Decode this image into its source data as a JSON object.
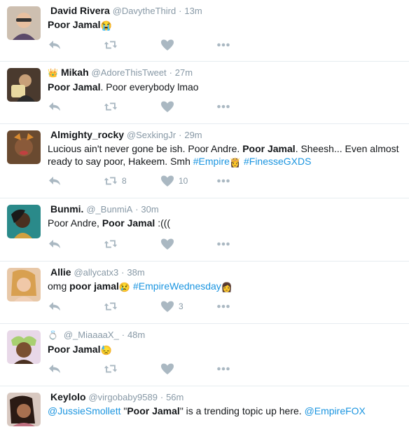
{
  "tweets": [
    {
      "name": "David Rivera",
      "badge": "",
      "handle": "@DavytheThird",
      "time": "13m",
      "segments": [
        {
          "t": "Poor Jamal",
          "s": "b"
        },
        {
          "t": " 😭",
          "s": "e"
        }
      ],
      "retweets": "",
      "likes": "",
      "avatar_color": "#c9b8a8"
    },
    {
      "name": "Mikah",
      "badge": "👑",
      "handle": "@AdoreThisTweet",
      "time": "27m",
      "segments": [
        {
          "t": "Poor Jamal",
          "s": "b"
        },
        {
          "t": ". Poor everybody lmao",
          "s": "n"
        }
      ],
      "retweets": "",
      "likes": "",
      "avatar_color": "#5a4a3a"
    },
    {
      "name": "Almighty_rocky",
      "badge": "",
      "handle": "@SexkingJr",
      "time": "29m",
      "segments": [
        {
          "t": "Lucious ain't never gone be ish. Poor Andre. ",
          "s": "n"
        },
        {
          "t": "Poor Jamal",
          "s": "b"
        },
        {
          "t": ". Sheesh... Even almost ready to say poor, Hakeem. Smh ",
          "s": "n"
        },
        {
          "t": "#Empire",
          "s": "l"
        },
        {
          "t": "👸",
          "s": "e"
        },
        {
          "t": " #FinesseGXDS",
          "s": "l"
        }
      ],
      "retweets": "8",
      "likes": "10",
      "avatar_color": "#7a5a3a"
    },
    {
      "name": "Bunmi.",
      "badge": "",
      "handle": "@_BunmiA",
      "time": "30m",
      "segments": [
        {
          "t": "Poor Andre, ",
          "s": "n"
        },
        {
          "t": "Poor Jamal",
          "s": "b"
        },
        {
          "t": " :(((",
          "s": "n"
        }
      ],
      "retweets": "",
      "likes": "",
      "avatar_color": "#3a6a7a"
    },
    {
      "name": "Allie",
      "badge": "",
      "handle": "@allycatx3",
      "time": "38m",
      "segments": [
        {
          "t": "omg ",
          "s": "n"
        },
        {
          "t": "poor jamal",
          "s": "b"
        },
        {
          "t": "😢",
          "s": "e"
        },
        {
          "t": " #EmpireWednesday",
          "s": "l"
        },
        {
          "t": "👩",
          "s": "e"
        }
      ],
      "retweets": "",
      "likes": "3",
      "avatar_color": "#d8b090"
    },
    {
      "name": "",
      "badge": "💍",
      "handle": "@_MiaaaaX_",
      "time": "48m",
      "segments": [
        {
          "t": "Poor Jamal",
          "s": "b"
        },
        {
          "t": " 😓",
          "s": "e"
        }
      ],
      "retweets": "",
      "likes": "",
      "avatar_color": "#b89070"
    },
    {
      "name": "Keylolo",
      "badge": "",
      "handle": "@virgobaby9589",
      "time": "56m",
      "segments": [
        {
          "t": "@JussieSmollett",
          "s": "l"
        },
        {
          "t": " \"",
          "s": "n"
        },
        {
          "t": "Poor Jamal",
          "s": "b"
        },
        {
          "t": "\" is a trending topic up here. ",
          "s": "n"
        },
        {
          "t": "@EmpireFOX",
          "s": "l"
        }
      ],
      "retweets": "",
      "likes": "",
      "avatar_color": "#a07860"
    }
  ]
}
